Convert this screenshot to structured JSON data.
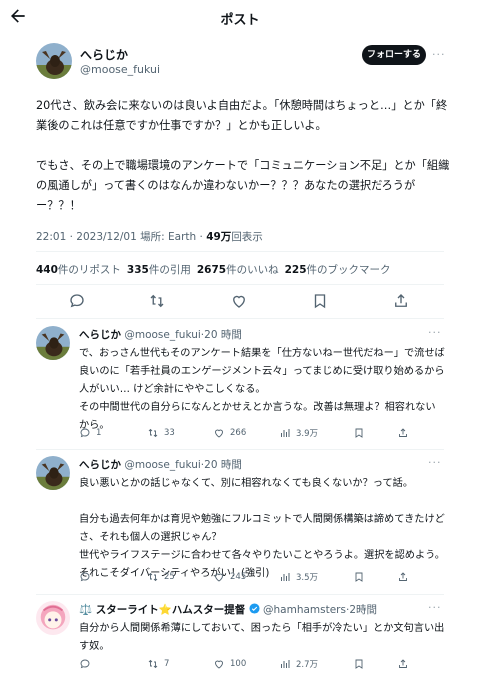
{
  "header": {
    "title": "ポスト"
  },
  "main_post": {
    "name": "へらじか",
    "handle": "@moose_fukui",
    "follow_label": "フォローする",
    "text": "20代さ、飲み会に来ないのは良いよ自由だよ。「休憩時間はちょっと…」とか「終業後のこれは任意ですか仕事ですか？」とかも正しいよ。\n\nでもさ、その上で職場環境のアンケートで「コミュニケーション不足」とか「組織の風通しが」って書くのはなんか違わないかー？？？あなたの選択だろうがー？？！",
    "timestamp": "22:01 · 2023/12/01 場所: Earth · ",
    "views_count": "49万",
    "views_label": "回表示",
    "stats": {
      "reposts_count": "440",
      "reposts_label": "件のリポスト",
      "quotes_count": "335",
      "quotes_label": "件の引用",
      "likes_count": "2675",
      "likes_label": "件のいいね",
      "bookmarks_count": "225",
      "bookmarks_label": "件のブックマーク"
    }
  },
  "replies": [
    {
      "name": "へらじか",
      "handle": "@moose_fukui",
      "time": "·20 時間",
      "text": "で、おっさん世代もそのアンケート結果を「仕方ないねー世代だねー」で流せば良いのに「若手社員のエンゲージメント云々」ってまじめに受け取り始めるから人がいい… けど余計にややこしくなる。\nその中間世代の自分らになんとかせえとか言うな。改善は無理よ？相容れないから。",
      "replies_count": "1",
      "reposts_count": "33",
      "likes_count": "266",
      "views_count": "3.9万"
    },
    {
      "name": "へらじか",
      "handle": "@moose_fukui",
      "time": "·20 時間",
      "text": "良い悪いとかの話じゃなくて、別に相容れなくても良くないか？って話。\n\n自分も過去何年かは育児や勉強にフルコミットで人間関係構築は諦めてきたけどさ、それも個人の選択じゃん？\n世代やライフステージに合わせて各々やりたいことやろうよ。選択を認めよう。それこそダイバーシティやろがい！(強引)",
      "replies_count": "",
      "reposts_count": "25",
      "likes_count": "245",
      "views_count": "3.5万"
    },
    {
      "name_prefix": "⚖️ スターライト",
      "name_star": "⭐",
      "name_suffix": "ハムスター提督",
      "handle": "@hamhamsters",
      "time": "·2時間",
      "text": "自分から人間関係希薄にしておいて、困ったら「相手が冷たい」とか文句言い出す奴。",
      "replies_count": "",
      "reposts_count": "7",
      "likes_count": "100",
      "views_count": "2.7万"
    }
  ],
  "colors": {
    "text": "#0f1419",
    "muted": "#536471",
    "divider": "#eff3f4",
    "verified": "#1d9bf0"
  },
  "icons": [
    "back-arrow-icon",
    "more-icon",
    "reply-icon",
    "repost-icon",
    "like-icon",
    "bookmark-icon",
    "share-icon",
    "views-icon",
    "verified-badge-icon"
  ]
}
